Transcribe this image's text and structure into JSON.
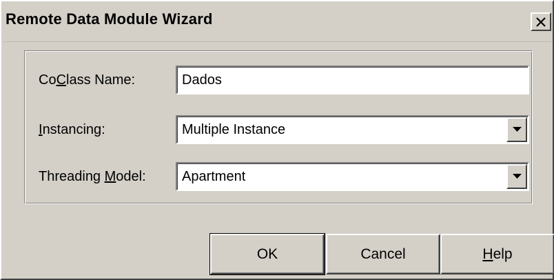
{
  "window": {
    "title": "Remote Data Module Wizard",
    "close_icon": "close-icon"
  },
  "form": {
    "coclass": {
      "label_pre": "Co",
      "label_accel": "C",
      "label_post": "lass Name:",
      "value": "Dados"
    },
    "instancing": {
      "label_pre": "",
      "label_accel": "I",
      "label_post": "nstancing:",
      "selected": "Multiple Instance"
    },
    "threading": {
      "label_pre": "Threading ",
      "label_accel": "M",
      "label_post": "odel:",
      "selected": "Apartment"
    }
  },
  "buttons": {
    "ok": "OK",
    "cancel": "Cancel",
    "help_accel": "H",
    "help_post": "elp"
  },
  "colors": {
    "face": "#d4d0c8",
    "highlight": "#ffffff",
    "shadow": "#808080",
    "dark_shadow": "#404040"
  }
}
